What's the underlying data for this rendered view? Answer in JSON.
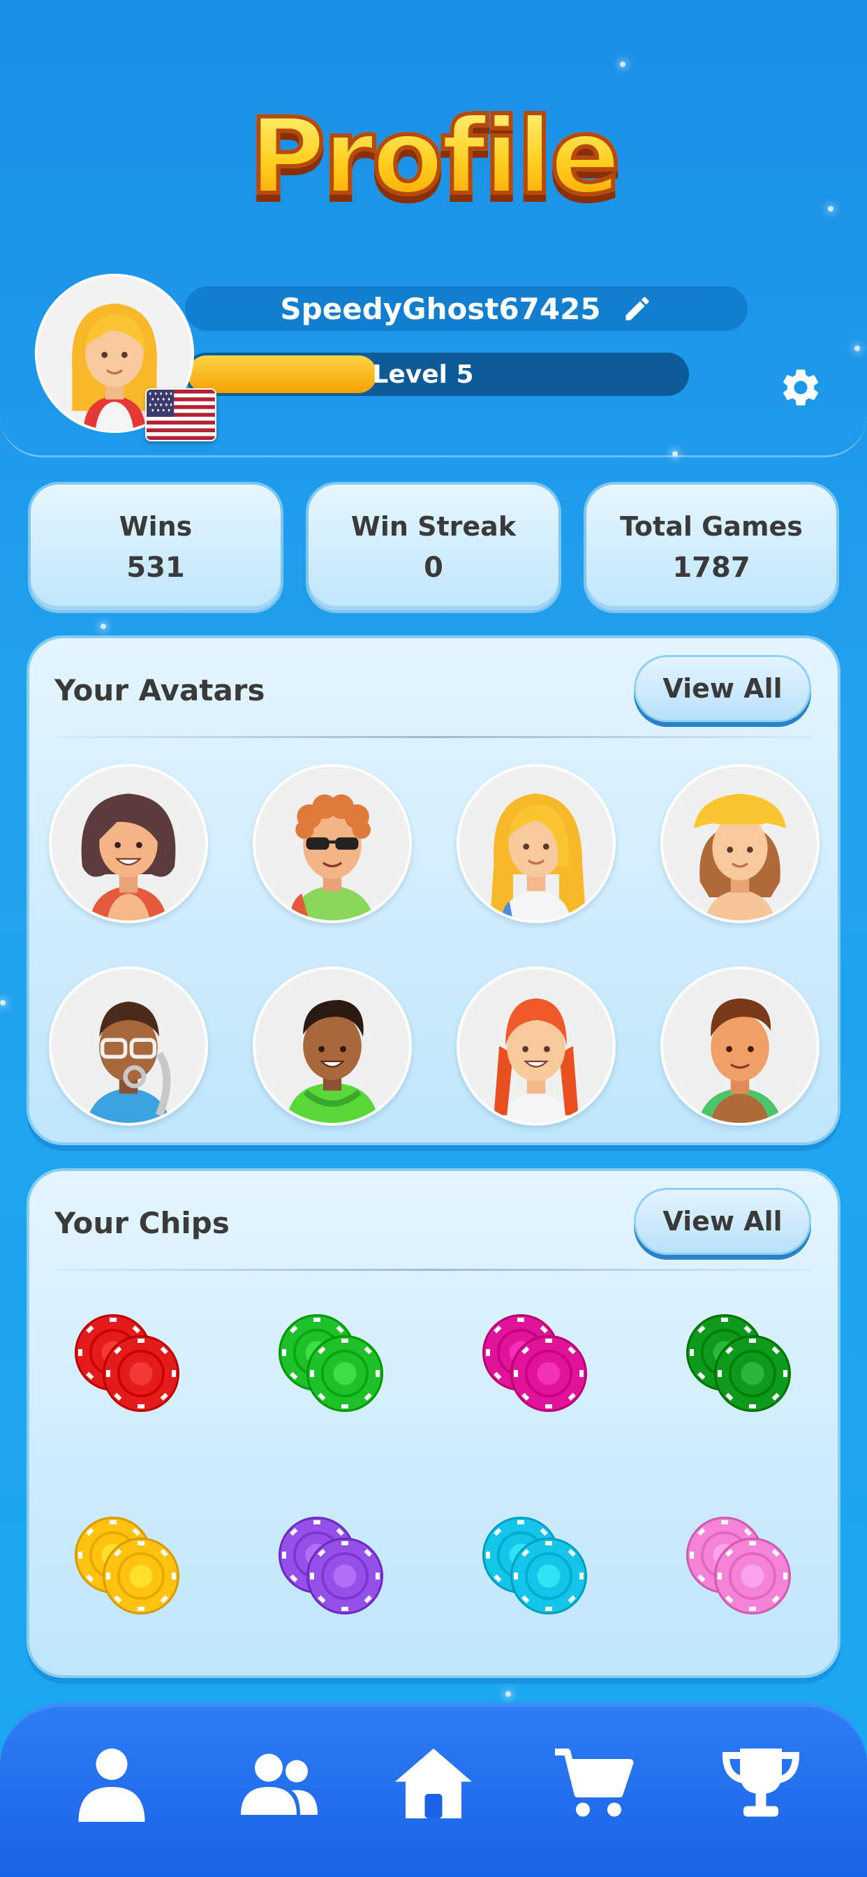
{
  "screen": {
    "title": "Profile"
  },
  "profile": {
    "username": "SpeedyGhost67425",
    "level_label": "Level 5",
    "level_progress": 0.38,
    "country_flag": "us-flag"
  },
  "stats": [
    {
      "label": "Wins",
      "value": "531"
    },
    {
      "label": "Win Streak",
      "value": "0"
    },
    {
      "label": "Total Games",
      "value": "1787"
    }
  ],
  "avatars_section": {
    "title": "Your Avatars",
    "view_all_label": "View All",
    "avatars": [
      "woman-brown-bob-avatar",
      "man-curly-sunglasses-avatar",
      "woman-blonde-long-avatar",
      "woman-yellow-hat-avatar",
      "man-glasses-headphones-avatar",
      "man-green-hoodie-avatar",
      "girl-red-braids-avatar",
      "man-brown-hair-avatar"
    ]
  },
  "chips_section": {
    "title": "Your Chips",
    "view_all_label": "View All",
    "chips": [
      {
        "name": "red-chip",
        "color": "#e41b1b"
      },
      {
        "name": "green-chip",
        "color": "#1fc12a"
      },
      {
        "name": "magenta-chip",
        "color": "#e0139a"
      },
      {
        "name": "dark-green-chip",
        "color": "#0e9a1c"
      },
      {
        "name": "yellow-chip",
        "color": "#ffc20e"
      },
      {
        "name": "purple-chip",
        "color": "#9550ea"
      },
      {
        "name": "cyan-chip",
        "color": "#13c6e9"
      },
      {
        "name": "pink-chip",
        "color": "#f783d8"
      }
    ]
  },
  "nav": [
    {
      "name": "profile-icon",
      "active": true
    },
    {
      "name": "friends-icon",
      "active": false
    },
    {
      "name": "home-icon",
      "active": false
    },
    {
      "name": "shop-cart-icon",
      "active": false
    },
    {
      "name": "trophy-icon",
      "active": false
    }
  ],
  "colors": {
    "background": "#1a8fe6",
    "title_fill": "#ffd21e",
    "level_fill": "#f5a100",
    "nav_bar": "#1a63e6"
  }
}
